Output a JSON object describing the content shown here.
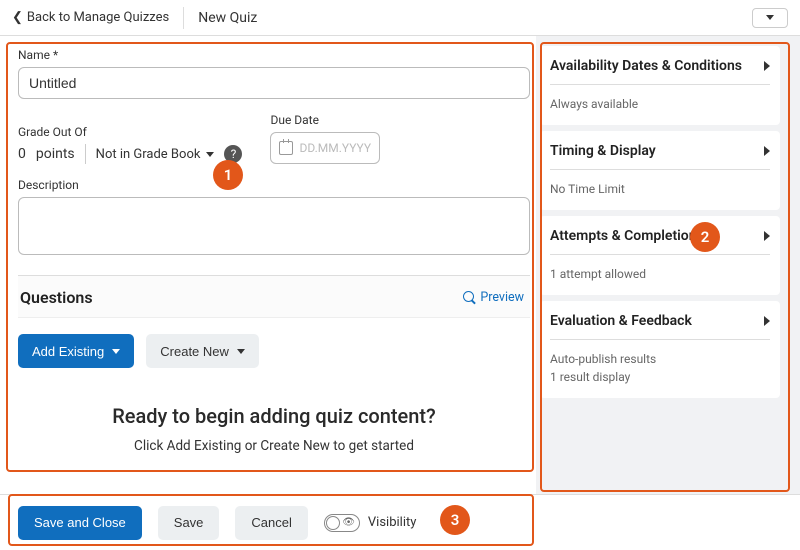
{
  "topbar": {
    "back_label": "Back to Manage Quizzes",
    "title": "New Quiz"
  },
  "form": {
    "name_label": "Name",
    "name_value": "Untitled",
    "grade_label": "Grade Out Of",
    "points_value": "0",
    "points_unit": "points",
    "gradebook_label": "Not in Grade Book",
    "due_date_label": "Due Date",
    "due_date_placeholder": "DD.MM.YYYY",
    "description_label": "Description"
  },
  "questions": {
    "header": "Questions",
    "preview_label": "Preview",
    "add_existing_label": "Add Existing",
    "create_new_label": "Create New",
    "ready_heading": "Ready to begin adding quiz content?",
    "ready_sub": "Click Add Existing or Create New to get started"
  },
  "sidebar": {
    "panels": [
      {
        "title": "Availability Dates & Conditions",
        "sub": "Always available"
      },
      {
        "title": "Timing & Display",
        "sub": "No Time Limit"
      },
      {
        "title": "Attempts & Completion",
        "sub": "1 attempt allowed"
      },
      {
        "title": "Evaluation & Feedback",
        "sub": "Auto-publish results\n1 result display"
      }
    ]
  },
  "footer": {
    "save_close": "Save and Close",
    "save": "Save",
    "cancel": "Cancel",
    "visibility": "Visibility"
  },
  "annotations": {
    "a1": "1",
    "a2": "2",
    "a3": "3"
  },
  "colors": {
    "accent": "#106ebe",
    "callout": "#e2571a"
  }
}
